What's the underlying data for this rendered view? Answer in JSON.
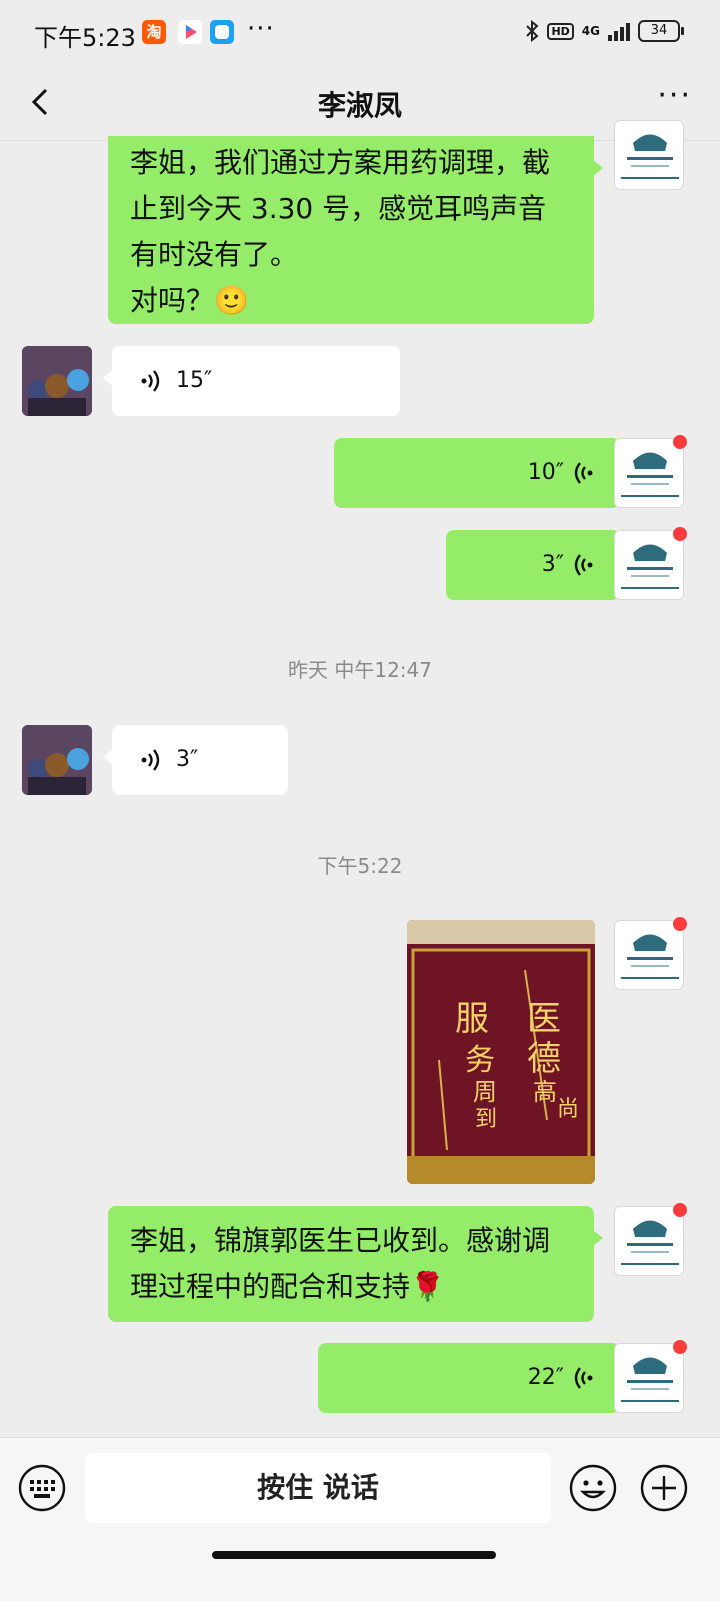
{
  "status_bar": {
    "time": "下午5:23",
    "taobao_icon_text": "淘",
    "more_dots": "···",
    "hd_badge": "HD",
    "network": "4G",
    "battery": "34"
  },
  "header": {
    "title": "李淑凤",
    "more": "···"
  },
  "messages": [
    {
      "sender": "me",
      "type": "text",
      "text": "李姐，我们通过方案用药调理，截止到今天 3.30 号，感觉耳鸣声音有时没有了。\n对吗？🙂"
    },
    {
      "sender": "other",
      "type": "voice",
      "duration": "15″"
    },
    {
      "sender": "me",
      "type": "voice",
      "duration": "10″"
    },
    {
      "sender": "me",
      "type": "voice",
      "duration": "3″"
    },
    {
      "type": "time",
      "text": "昨天 中午12:47"
    },
    {
      "sender": "other",
      "type": "voice",
      "duration": "3″"
    },
    {
      "type": "time",
      "text": "下午5:22"
    },
    {
      "sender": "me",
      "type": "image",
      "banner_text": [
        "医",
        "德",
        "高",
        "尚",
        "服",
        "务",
        "周",
        "到"
      ]
    },
    {
      "sender": "me",
      "type": "text",
      "text": "李姐，锦旗郭医生已收到。感谢调理过程中的配合和支持🌹"
    },
    {
      "sender": "me",
      "type": "voice",
      "duration": "22″"
    }
  ],
  "bottom_bar": {
    "hold_to_talk": "按住 说话"
  },
  "colors": {
    "my_bubble": "#95ec69",
    "other_bubble": "#ffffff",
    "background": "#ededed",
    "unread_dot": "#fa3c3c"
  }
}
